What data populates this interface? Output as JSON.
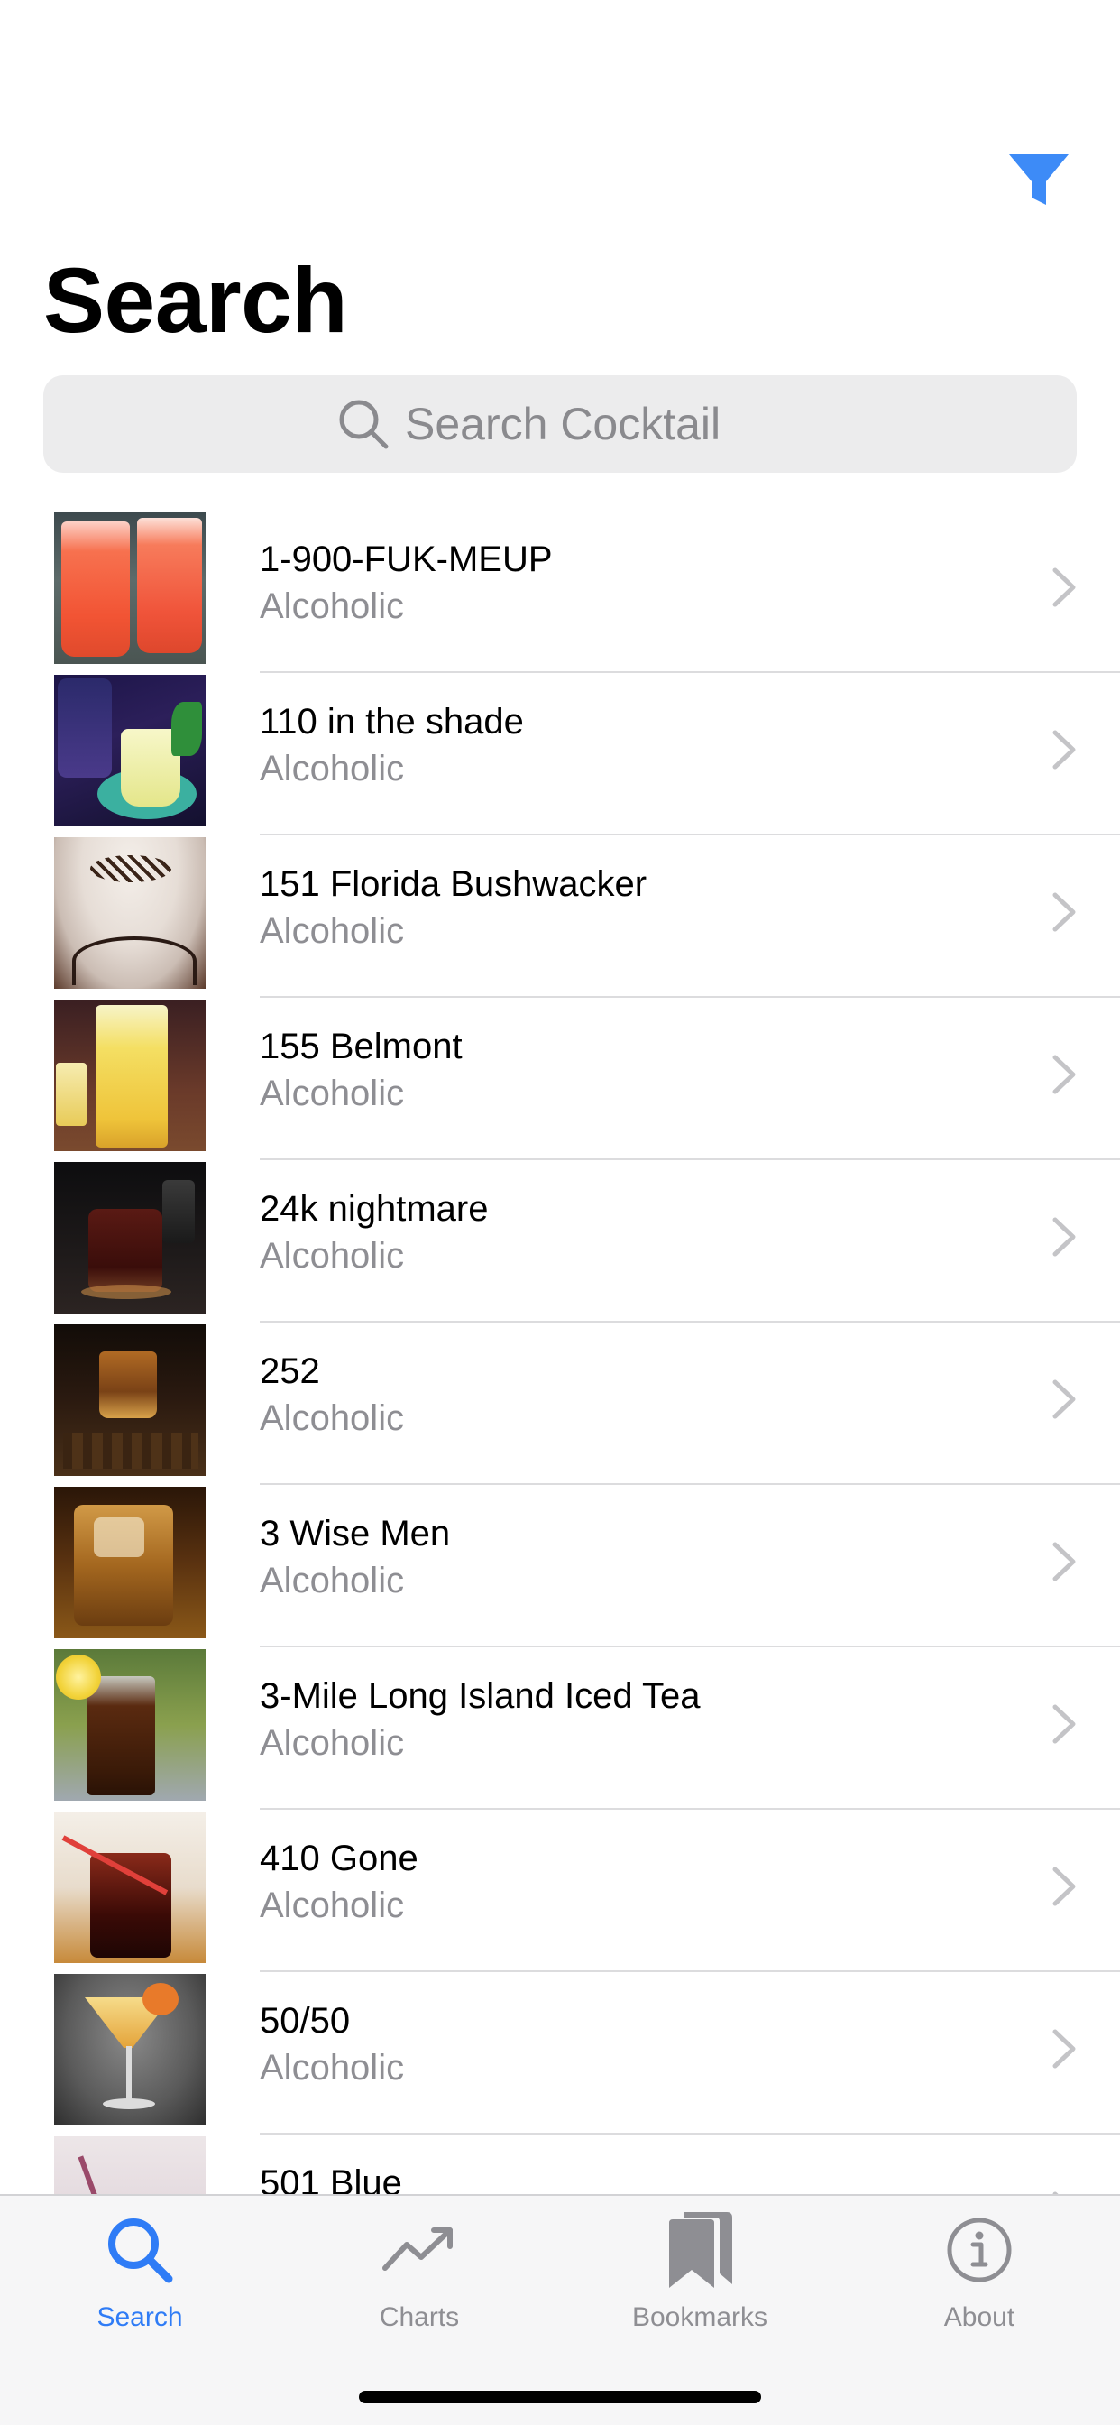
{
  "colors": {
    "accent": "#2F7CF6",
    "filter_icon": "#3D8BF7",
    "tab_inactive": "#8E8E93",
    "secondary_text": "#8E8E93",
    "search_field_bg": "#ECECED"
  },
  "header": {
    "filter_icon": "funnel-filter-icon",
    "title": "Search"
  },
  "search": {
    "icon": "magnifying-glass-icon",
    "placeholder": "Search Cocktail",
    "value": ""
  },
  "cocktails": [
    {
      "name": "1-900-FUK-MEUP",
      "category": "Alcoholic",
      "thumb": "red-punch-glasses"
    },
    {
      "name": "110 in the shade",
      "category": "Alcoholic",
      "thumb": "lemonade-glass-bottle"
    },
    {
      "name": "151 Florida Bushwacker",
      "category": "Alcoholic",
      "thumb": "creamy-chocolate-drink"
    },
    {
      "name": "155 Belmont",
      "category": "Alcoholic",
      "thumb": "yellow-tall-glass"
    },
    {
      "name": "24k nightmare",
      "category": "Alcoholic",
      "thumb": "dark-shot-glass"
    },
    {
      "name": "252",
      "category": "Alcoholic",
      "thumb": "amber-shot-glass"
    },
    {
      "name": "3 Wise Men",
      "category": "Alcoholic",
      "thumb": "whiskey-on-ice"
    },
    {
      "name": "3-Mile Long Island Iced Tea",
      "category": "Alcoholic",
      "thumb": "iced-tea-lemon"
    },
    {
      "name": "410 Gone",
      "category": "Alcoholic",
      "thumb": "cola-with-straw"
    },
    {
      "name": "50/50",
      "category": "Alcoholic",
      "thumb": "martini-orange-peel"
    },
    {
      "name": "501 Blue",
      "category": "",
      "thumb": "blue-drink-partial"
    }
  ],
  "tabs": [
    {
      "label": "Search",
      "icon": "search-icon",
      "active": true
    },
    {
      "label": "Charts",
      "icon": "chart-trend-icon",
      "active": false
    },
    {
      "label": "Bookmarks",
      "icon": "bookmarks-icon",
      "active": false
    },
    {
      "label": "About",
      "icon": "info-circle-icon",
      "active": false
    }
  ]
}
